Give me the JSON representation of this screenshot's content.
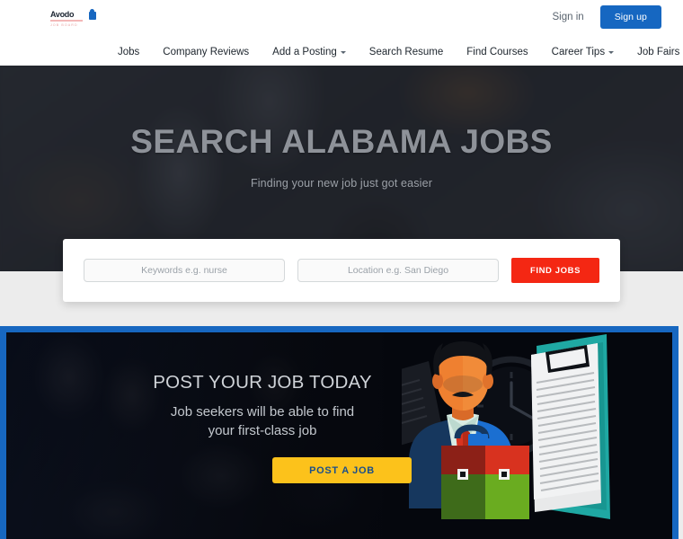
{
  "header": {
    "logo": {
      "word": "Avodo",
      "tagline": "JOB BOARD",
      "mark": "pin-icon"
    },
    "signin_label": "Sign in",
    "signup_label": "Sign up",
    "nav_items": [
      {
        "label": "Jobs",
        "has_caret": false
      },
      {
        "label": "Company Reviews",
        "has_caret": false
      },
      {
        "label": "Add a Posting",
        "has_caret": true
      },
      {
        "label": "Search Resume",
        "has_caret": false
      },
      {
        "label": "Find Courses",
        "has_caret": false
      },
      {
        "label": "Career Tips",
        "has_caret": true
      },
      {
        "label": "Job Fairs",
        "has_caret": false
      }
    ]
  },
  "hero": {
    "title": "SEARCH ALABAMA JOBS",
    "subtitle": "Finding your new job just got easier"
  },
  "search": {
    "keywords_placeholder": "Keywords e.g. nurse",
    "keywords_value": "",
    "location_placeholder": "Location e.g. San Diego",
    "location_value": "",
    "find_jobs_label": "FIND JOBS"
  },
  "banner": {
    "title": "POST YOUR JOB TODAY",
    "subtitle_line1": "Job seekers will be able to find",
    "subtitle_line2": "your first-class job",
    "cta_label": "POST A JOB"
  },
  "colors": {
    "brand_blue": "#1767c0",
    "signup_blue": "#1667c1",
    "find_jobs_red": "#f42713",
    "post_job_yellow": "#fcc21b",
    "post_job_text": "#1b4f8a",
    "hero_dark": "#2b2f38",
    "page_gray": "#ececec",
    "banner_dark": "#05070d"
  }
}
